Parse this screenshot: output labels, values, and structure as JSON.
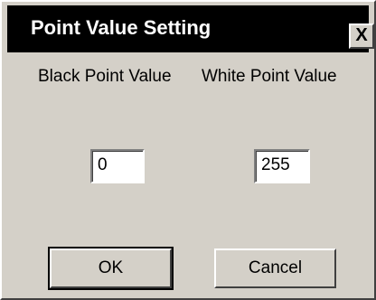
{
  "window": {
    "title": "Point Value Setting",
    "close_label": "X"
  },
  "labels": {
    "black_point": "Black Point Value",
    "white_point": "White Point Value"
  },
  "fields": {
    "black_point_value": "0",
    "white_point_value": "255"
  },
  "buttons": {
    "ok_label": "OK",
    "cancel_label": "Cancel"
  },
  "colors": {
    "dialog_background": "#d4d0c8",
    "titlebar": "#000000",
    "title_text": "#ffffff"
  }
}
